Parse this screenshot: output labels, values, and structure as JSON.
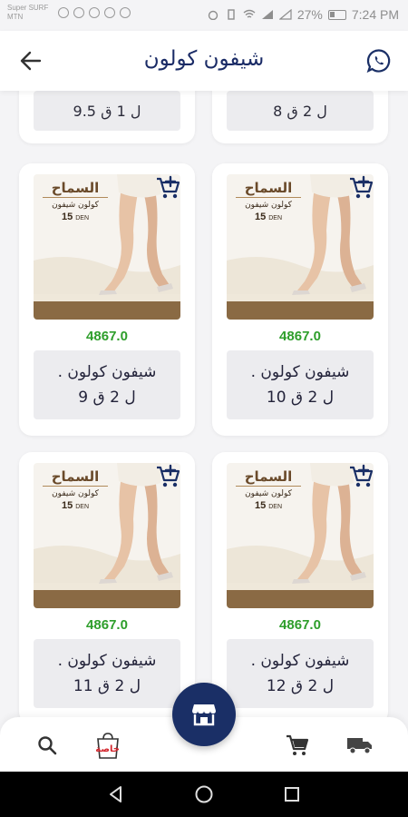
{
  "status_bar": {
    "carrier_line1": "Super SURF",
    "carrier_line2": "MTN",
    "battery": "27%",
    "time": "7:24 PM"
  },
  "header": {
    "title": "شيفون كولون",
    "back_icon": "arrow-left-icon",
    "whatsapp_icon": "whatsapp-icon"
  },
  "products_partial": [
    {
      "size": "ل 2 ق 8"
    },
    {
      "size": "ل 1 ق 9.5"
    }
  ],
  "products": [
    {
      "price": "4867.0",
      "name": "شيفون كولون .",
      "size": "ل 2 ق 10"
    },
    {
      "price": "4867.0",
      "name": "شيفون كولون .",
      "size": "ل 2 ق 9"
    },
    {
      "price": "4867.0",
      "name": "شيفون كولون .",
      "size": "ل 2 ق 12"
    },
    {
      "price": "4867.0",
      "name": "شيفون كولون .",
      "size": "ل 2 ق 11"
    }
  ],
  "product_image": {
    "brand": "السماح",
    "product_line": "كولون شيفون",
    "den_number": "15",
    "den_unit": "DEN"
  },
  "colors": {
    "primary": "#1a2f66",
    "price": "#2e9e2b"
  },
  "bottom_nav": {
    "items": [
      "search-icon",
      "store-logo",
      "store-icon",
      "cart-icon",
      "delivery-truck-icon"
    ],
    "logo_text": "خاصة"
  },
  "system_nav": [
    "back-icon",
    "home-icon",
    "recents-icon"
  ]
}
